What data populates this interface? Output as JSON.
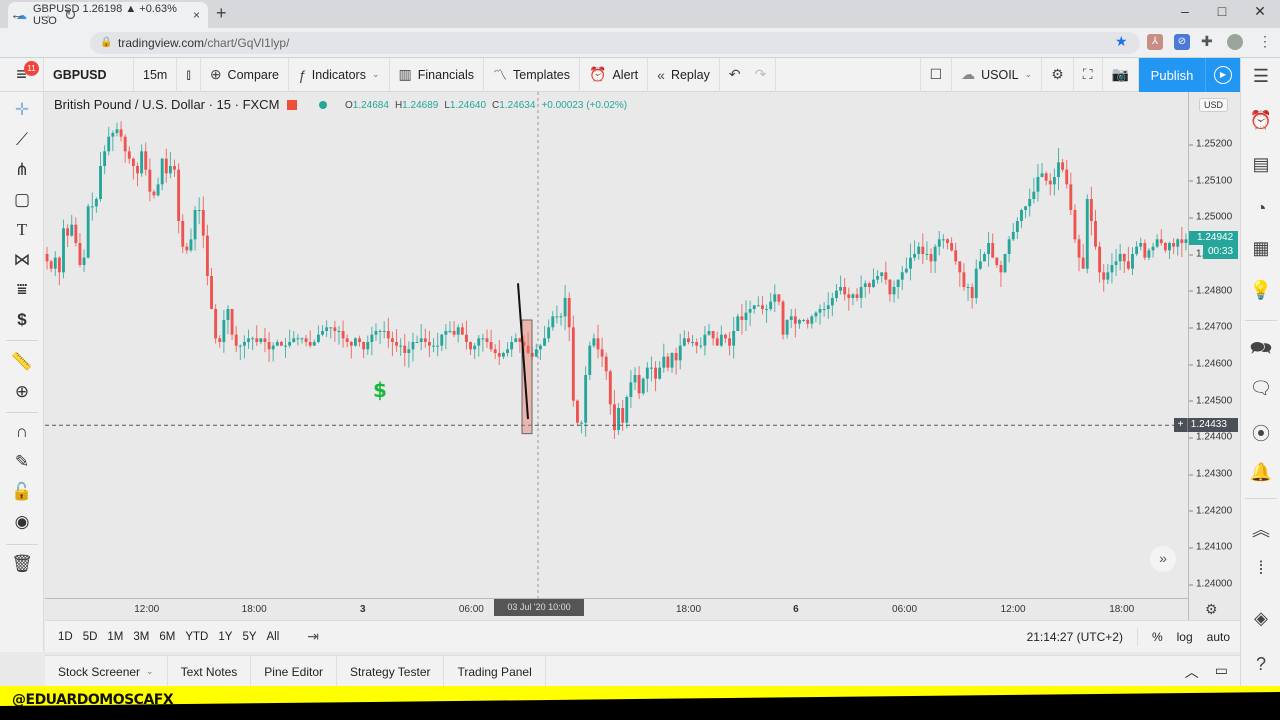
{
  "browser": {
    "tab_title": "GBPUSD 1.26198 ▲ +0.63% USO",
    "url_host": "tradingview.com",
    "url_path": "/chart/GqVl1lyp/",
    "new_tab": "+",
    "close_tab": "×",
    "window": {
      "minimize": "–",
      "maximize": "□",
      "close": "✕"
    }
  },
  "toolbar": {
    "menu_badge": "11",
    "symbol": "GBPUSD",
    "interval": "15m",
    "compare": "Compare",
    "indicators": "Indicators",
    "financials": "Financials",
    "templates": "Templates",
    "alert": "Alert",
    "replay": "Replay",
    "watch_symbol": "USOIL",
    "publish": "Publish"
  },
  "legend": {
    "title": "British Pound / U.S. Dollar · 15 · FXCM",
    "o_label": "O",
    "o": "1.24684",
    "h_label": "H",
    "h": "1.24689",
    "l_label": "L",
    "l": "1.24640",
    "c_label": "C",
    "c": "1.24634",
    "change": "+0.00023 (+0.02%)"
  },
  "price_axis": {
    "currency": "USD",
    "last_price": "1.24942",
    "countdown": "00:33",
    "crosshair_price": "1.24433"
  },
  "time_axis": {
    "crosshair_time": "03 Jul '20  10:00",
    "settings_icon": "gear"
  },
  "range_bar": {
    "ranges": [
      "1D",
      "5D",
      "1M",
      "3M",
      "6M",
      "YTD",
      "1Y",
      "5Y",
      "All"
    ],
    "clock": "21:14:27 (UTC+2)",
    "percent": "%",
    "log": "log",
    "auto": "auto"
  },
  "bottom_tabs": [
    "Stock Screener",
    "Text Notes",
    "Pine Editor",
    "Strategy Tester",
    "Trading Panel"
  ],
  "banner": {
    "text": "@EDUARDOMOSCAFX"
  },
  "colors": {
    "up": "#26a69a",
    "down": "#ef5350",
    "accent": "#2196f3"
  },
  "chart_data": {
    "type": "candlestick",
    "title": "British Pound / U.S. Dollar · 15 · FXCM",
    "ylim": [
      1.2396,
      1.2533
    ],
    "y_ticks": [
      "1.25200",
      "1.25100",
      "1.25000",
      "1.24900",
      "1.24800",
      "1.24700",
      "1.24600",
      "1.24500",
      "1.24400",
      "1.24300",
      "1.24200",
      "1.24100",
      "1.24000"
    ],
    "x_ticks": [
      {
        "label": "12:00",
        "pos": 0.082
      },
      {
        "label": "18:00",
        "pos": 0.176
      },
      {
        "label": "3",
        "pos": 0.271
      },
      {
        "label": "06:00",
        "pos": 0.366
      },
      {
        "label": "18:00",
        "pos": 0.556
      },
      {
        "label": "6",
        "pos": 0.65
      },
      {
        "label": "06:00",
        "pos": 0.745
      },
      {
        "label": "12:00",
        "pos": 0.84
      },
      {
        "label": "18:00",
        "pos": 0.935
      }
    ],
    "closes": [
      1.2488,
      1.2486,
      1.2489,
      1.2485,
      1.2497,
      1.2495,
      1.2498,
      1.2493,
      1.2487,
      1.2489,
      1.2503,
      1.2503,
      1.2505,
      1.2514,
      1.2518,
      1.2522,
      1.2523,
      1.2524,
      1.2522,
      1.2518,
      1.2516,
      1.2514,
      1.2512,
      1.2518,
      1.2513,
      1.2507,
      1.2506,
      1.2509,
      1.2516,
      1.2512,
      1.2514,
      1.2513,
      1.2499,
      1.2492,
      1.2491,
      1.2494,
      1.2502,
      1.2502,
      1.2495,
      1.2484,
      1.2475,
      1.2467,
      1.2466,
      1.2472,
      1.2475,
      1.2468,
      1.2465,
      1.2465,
      1.2466,
      1.2467,
      1.2467,
      1.2466,
      1.2467,
      1.2466,
      1.2464,
      1.2465,
      1.2466,
      1.2465,
      1.2465,
      1.2466,
      1.2467,
      1.2467,
      1.2467,
      1.2466,
      1.2465,
      1.2466,
      1.2468,
      1.2469,
      1.247,
      1.247,
      1.2469,
      1.2469,
      1.2467,
      1.2466,
      1.2465,
      1.2467,
      1.2466,
      1.2464,
      1.2466,
      1.2468,
      1.2469,
      1.2469,
      1.2469,
      1.2467,
      1.2466,
      1.2465,
      1.2465,
      1.2463,
      1.2464,
      1.2466,
      1.2466,
      1.2467,
      1.2466,
      1.2465,
      1.2465,
      1.2465,
      1.2468,
      1.2469,
      1.2469,
      1.2468,
      1.247,
      1.2468,
      1.2466,
      1.2464,
      1.2465,
      1.2467,
      1.2467,
      1.2466,
      1.2464,
      1.2463,
      1.2462,
      1.2463,
      1.2464,
      1.2466,
      1.2467,
      1.2466,
      1.2465,
      1.2463,
      1.2462,
      1.2464,
      1.2465,
      1.2467,
      1.247,
      1.2473,
      1.2473,
      1.2473,
      1.2478,
      1.247,
      1.245,
      1.2444,
      1.2444,
      1.2457,
      1.2465,
      1.2467,
      1.2464,
      1.2462,
      1.2458,
      1.2449,
      1.2442,
      1.2448,
      1.2444,
      1.2451,
      1.2455,
      1.2457,
      1.2452,
      1.2456,
      1.2459,
      1.2459,
      1.2456,
      1.2459,
      1.2462,
      1.2459,
      1.2463,
      1.2461,
      1.2465,
      1.2467,
      1.2466,
      1.2466,
      1.2465,
      1.2465,
      1.2468,
      1.2469,
      1.2467,
      1.2465,
      1.2468,
      1.2467,
      1.2465,
      1.2469,
      1.2473,
      1.2472,
      1.2474,
      1.2475,
      1.2476,
      1.2476,
      1.2475,
      1.2475,
      1.2477,
      1.2479,
      1.2477,
      1.2468,
      1.2472,
      1.2473,
      1.2471,
      1.2472,
      1.2472,
      1.2471,
      1.2473,
      1.2474,
      1.2475,
      1.2475,
      1.2476,
      1.2478,
      1.248,
      1.2481,
      1.2479,
      1.2478,
      1.2479,
      1.2478,
      1.2481,
      1.2482,
      1.2481,
      1.2483,
      1.2484,
      1.2485,
      1.2483,
      1.2479,
      1.2481,
      1.2483,
      1.2485,
      1.2486,
      1.2489,
      1.249,
      1.2492,
      1.249,
      1.249,
      1.2488,
      1.2492,
      1.2494,
      1.2494,
      1.2493,
      1.2491,
      1.2488,
      1.2485,
      1.2481,
      1.2481,
      1.2478,
      1.2486,
      1.2488,
      1.249,
      1.2493,
      1.2489,
      1.2487,
      1.2485,
      1.249,
      1.2494,
      1.2496,
      1.2499,
      1.2502,
      1.2503,
      1.2505,
      1.2507,
      1.2511,
      1.2512,
      1.251,
      1.2509,
      1.2511,
      1.2515,
      1.2513,
      1.2509,
      1.2502,
      1.2494,
      1.2489,
      1.2486,
      1.2505,
      1.2499,
      1.2492,
      1.2485,
      1.2483,
      1.2485,
      1.2487,
      1.2488,
      1.249,
      1.2488,
      1.2486,
      1.249,
      1.2492,
      1.2493,
      1.2489,
      1.2491,
      1.2492,
      1.2494,
      1.2493,
      1.2491,
      1.2493,
      1.2492,
      1.2494,
      1.2493,
      1.2494
    ]
  }
}
